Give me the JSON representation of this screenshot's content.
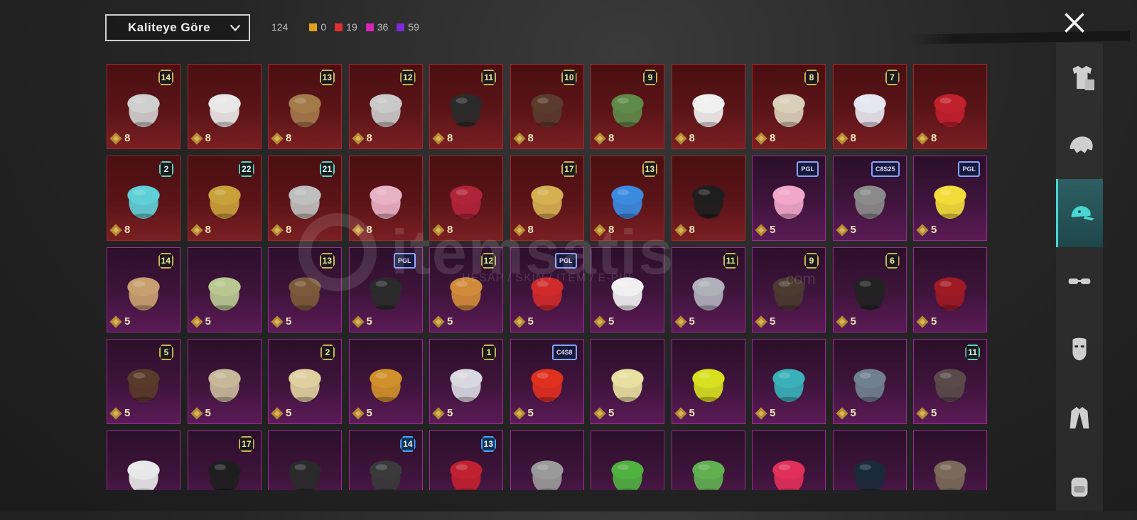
{
  "toolbar": {
    "sort_label": "Kaliteye Göre",
    "total_count": "124",
    "rarity_counts": [
      {
        "color": "#e0a317",
        "count": "0"
      },
      {
        "color": "#e0302e",
        "count": "19"
      },
      {
        "color": "#d625b6",
        "count": "36"
      },
      {
        "color": "#7c2ad8",
        "count": "59"
      }
    ]
  },
  "watermark": {
    "text": "itemsatis",
    "subtext": "HESAP / SKIN / İTEM / E-PIN",
    "domain": ".com"
  },
  "sidebar": {
    "tabs": [
      {
        "icon": "outfit-icon",
        "active": false
      },
      {
        "icon": "hairstyle-icon",
        "active": false
      },
      {
        "icon": "hat-icon",
        "active": true
      },
      {
        "icon": "goggles-icon",
        "active": false
      },
      {
        "icon": "mask-icon",
        "active": false
      },
      {
        "icon": "jacket-icon",
        "active": false
      },
      {
        "icon": "backpack-icon",
        "active": false
      }
    ]
  },
  "grid": {
    "items": [
      {
        "rarity": "red",
        "price": "8",
        "badge": "14",
        "art": "hood-helmet-icon",
        "art_color": "#cfcfcf"
      },
      {
        "rarity": "red",
        "price": "8",
        "badge": "",
        "art": "horned-hair-icon",
        "art_color": "#e8e8e8"
      },
      {
        "rarity": "red",
        "price": "8",
        "badge": "13",
        "art": "pirate-hat-icon",
        "art_color": "#a37a4a"
      },
      {
        "rarity": "red",
        "price": "8",
        "badge": "12",
        "art": "silver-hair-icon",
        "art_color": "#c9c9c9"
      },
      {
        "rarity": "red",
        "price": "8",
        "badge": "11",
        "art": "dark-helmet-icon",
        "art_color": "#2a2a2a"
      },
      {
        "rarity": "red",
        "price": "8",
        "badge": "10",
        "art": "brown-hair-icon",
        "art_color": "#5a3b2c"
      },
      {
        "rarity": "red",
        "price": "8",
        "badge": "9",
        "art": "zombie-head-icon",
        "art_color": "#5e8a4a"
      },
      {
        "rarity": "red",
        "price": "8",
        "badge": "",
        "art": "white-cowboy-hat-icon",
        "art_color": "#f0f0f0"
      },
      {
        "rarity": "red",
        "price": "8",
        "badge": "8",
        "art": "blonde-hair-icon",
        "art_color": "#d9d0b8"
      },
      {
        "rarity": "red",
        "price": "8",
        "badge": "7",
        "art": "white-long-hair-icon",
        "art_color": "#e6e6f0"
      },
      {
        "rarity": "red",
        "price": "8",
        "badge": "",
        "art": "red-helmet-icon",
        "art_color": "#c0202c"
      },
      {
        "rarity": "red",
        "price": "8",
        "badge": "2",
        "art": "cyan-bucket-hat-icon",
        "art_color": "#5fd0d8"
      },
      {
        "rarity": "red",
        "price": "8",
        "badge": "22",
        "art": "gold-mask-icon",
        "art_color": "#c8a13a"
      },
      {
        "rarity": "red",
        "price": "8",
        "badge": "21",
        "art": "clown-mask-icon",
        "art_color": "#bfbfbf"
      },
      {
        "rarity": "red",
        "price": "8",
        "badge": "",
        "art": "pink-hair-icon",
        "art_color": "#e7b2c4"
      },
      {
        "rarity": "red",
        "price": "8",
        "badge": "",
        "art": "oni-mask-icon",
        "art_color": "#b0243a"
      },
      {
        "rarity": "red",
        "price": "8",
        "badge": "17",
        "art": "gold-crown-helmet-icon",
        "art_color": "#d4b050"
      },
      {
        "rarity": "red",
        "price": "8",
        "badge": "13",
        "art": "blue-hero-helmet-icon",
        "art_color": "#3a8ae0"
      },
      {
        "rarity": "red",
        "price": "8",
        "badge": "",
        "art": "tricorn-hat-icon",
        "art_color": "#1e1e1e"
      },
      {
        "rarity": "purple",
        "price": "5",
        "badge": "PGL",
        "art": "bunny-ears-icon",
        "art_color": "#f0a7c8"
      },
      {
        "rarity": "purple",
        "price": "5",
        "badge": "C8S25",
        "art": "grey-hair-icon",
        "art_color": "#8a8a8a"
      },
      {
        "rarity": "purple",
        "price": "5",
        "badge": "PGL",
        "art": "yellow-box-head-icon",
        "art_color": "#f2dc3a"
      },
      {
        "rarity": "purple",
        "price": "5",
        "badge": "14",
        "art": "flower-hair-icon",
        "art_color": "#c8a070"
      },
      {
        "rarity": "purple",
        "price": "5",
        "badge": "",
        "art": "green-hair-icon",
        "art_color": "#b8c890"
      },
      {
        "rarity": "purple",
        "price": "5",
        "badge": "13",
        "art": "aviator-cap-icon",
        "art_color": "#7a5a3a"
      },
      {
        "rarity": "purple",
        "price": "5",
        "badge": "PGL",
        "art": "black-cap-icon",
        "art_color": "#2a2a2a"
      },
      {
        "rarity": "purple",
        "price": "5",
        "badge": "12",
        "art": "orange-hair-icon",
        "art_color": "#d08a3a"
      },
      {
        "rarity": "purple",
        "price": "5",
        "badge": "PGL",
        "art": "red-hair-icon",
        "art_color": "#d02a2a"
      },
      {
        "rarity": "purple",
        "price": "5",
        "badge": "",
        "art": "panda-head-icon",
        "art_color": "#f0f0f0"
      },
      {
        "rarity": "purple",
        "price": "5",
        "badge": "11",
        "art": "flower-veil-icon",
        "art_color": "#b0b0b8"
      },
      {
        "rarity": "purple",
        "price": "5",
        "badge": "9",
        "art": "ponytail-hair-icon",
        "art_color": "#4a3a30"
      },
      {
        "rarity": "purple",
        "price": "5",
        "badge": "6",
        "art": "black-visor-helmet-icon",
        "art_color": "#222"
      },
      {
        "rarity": "purple",
        "price": "5",
        "badge": "",
        "art": "red-creature-hat-icon",
        "art_color": "#a01a24"
      },
      {
        "rarity": "purple",
        "price": "5",
        "badge": "5",
        "art": "cat-ears-hair-icon",
        "art_color": "#5a3a2a"
      },
      {
        "rarity": "purple",
        "price": "5",
        "badge": "",
        "art": "curly-blonde-hair-icon",
        "art_color": "#c8b89a"
      },
      {
        "rarity": "purple",
        "price": "5",
        "badge": "2",
        "art": "beige-cap-icon",
        "art_color": "#e0d0a0"
      },
      {
        "rarity": "purple",
        "price": "5",
        "badge": "",
        "art": "potato-head-icon",
        "art_color": "#d0902a"
      },
      {
        "rarity": "purple",
        "price": "5",
        "badge": "1",
        "art": "white-pigtails-icon",
        "art_color": "#d8d8e0"
      },
      {
        "rarity": "purple",
        "price": "5",
        "badge": "C4S8",
        "art": "red-cap-icon",
        "art_color": "#e0301e"
      },
      {
        "rarity": "purple",
        "price": "5",
        "badge": "",
        "art": "yellow-helmet-icon",
        "art_color": "#e8e0a0"
      },
      {
        "rarity": "purple",
        "price": "5",
        "badge": "",
        "art": "yellow-bucket-hat-icon",
        "art_color": "#d8e020"
      },
      {
        "rarity": "purple",
        "price": "5",
        "badge": "",
        "art": "teal-monkey-head-icon",
        "art_color": "#3ab0b8"
      },
      {
        "rarity": "purple",
        "price": "5",
        "badge": "",
        "art": "shark-head-icon",
        "art_color": "#708090"
      },
      {
        "rarity": "purple",
        "price": "5",
        "badge": "11",
        "art": "goat-head-icon",
        "art_color": "#5a4a4a"
      },
      {
        "rarity": "purple",
        "price": "",
        "badge": "",
        "art": "paper-bag-hat-icon",
        "art_color": "#e8e8e8"
      },
      {
        "rarity": "purple",
        "price": "",
        "badge": "17",
        "art": "black-bowler-hat-icon",
        "art_color": "#1e1e1e"
      },
      {
        "rarity": "purple",
        "price": "",
        "badge": "",
        "art": "ninja-helmet-icon",
        "art_color": "#2a2a2a"
      },
      {
        "rarity": "purple",
        "price": "",
        "badge": "14",
        "art": "officer-cap-icon",
        "art_color": "#3a3a3a"
      },
      {
        "rarity": "purple",
        "price": "",
        "badge": "13",
        "art": "red-warrior-mask-icon",
        "art_color": "#c02030"
      },
      {
        "rarity": "purple",
        "price": "",
        "badge": "",
        "art": "dreadlocks-hair-icon",
        "art_color": "#9a9a9a"
      },
      {
        "rarity": "purple",
        "price": "",
        "badge": "",
        "art": "frog-cap-icon",
        "art_color": "#50b040"
      },
      {
        "rarity": "purple",
        "price": "",
        "badge": "",
        "art": "frog-police-cap-icon",
        "art_color": "#60b050"
      },
      {
        "rarity": "purple",
        "price": "",
        "badge": "",
        "art": "red-wig-cap-icon",
        "art_color": "#e0305a"
      },
      {
        "rarity": "purple",
        "price": "",
        "badge": "",
        "art": "black-space-helmet-icon",
        "art_color": "#1a2a3a"
      },
      {
        "rarity": "purple",
        "price": "",
        "badge": "",
        "art": "antlers-icon",
        "art_color": "#7a6a5a"
      }
    ]
  }
}
